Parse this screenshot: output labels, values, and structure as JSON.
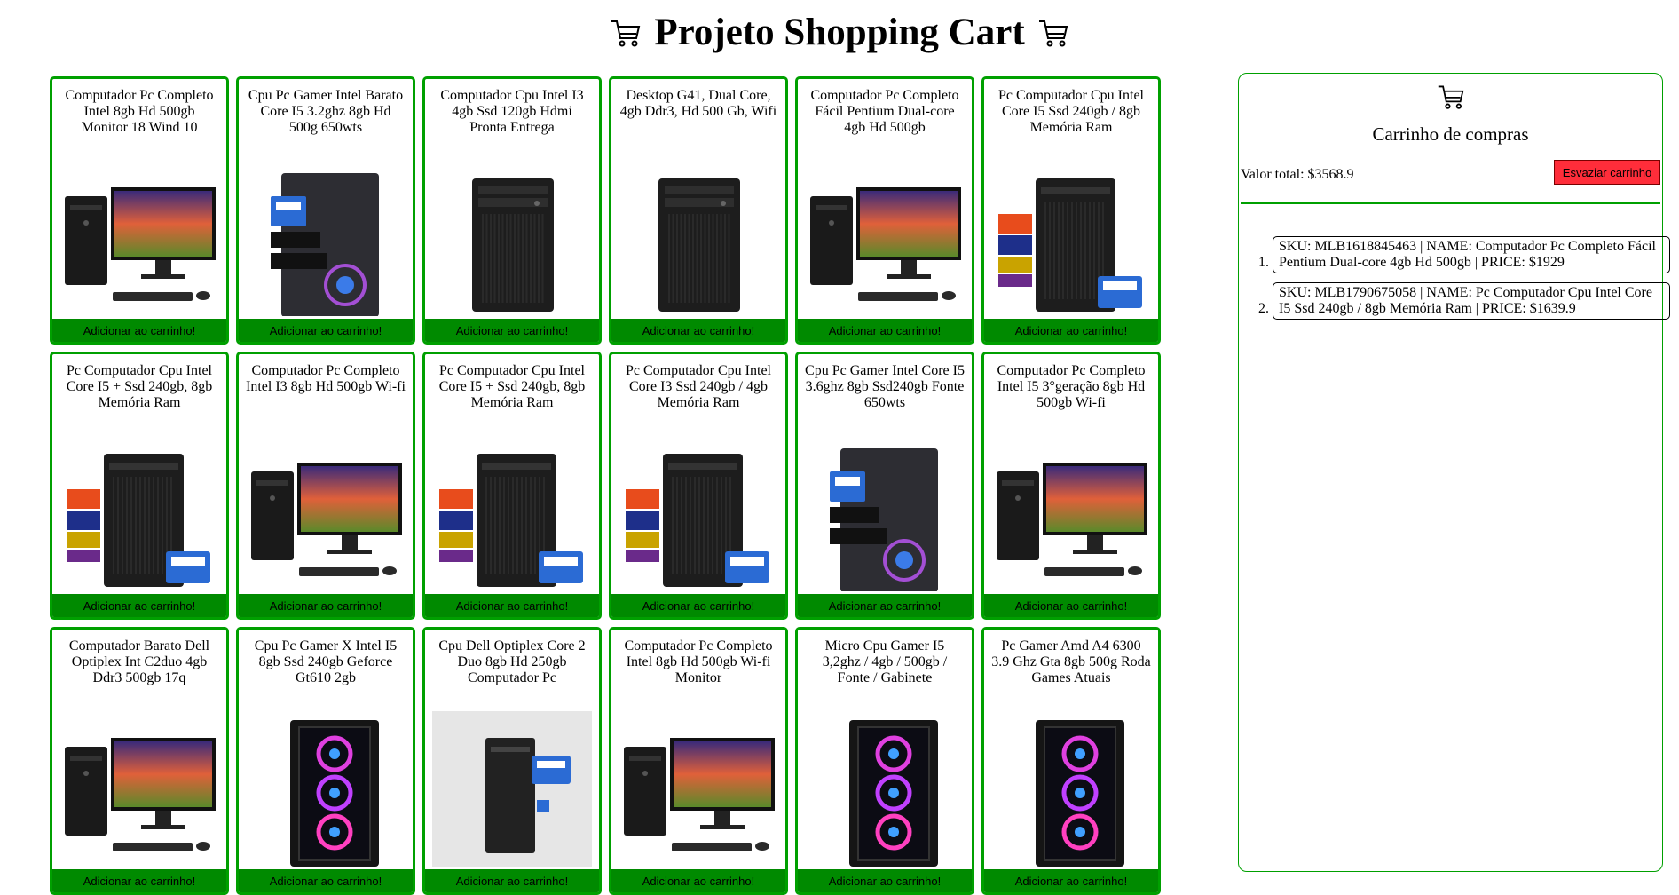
{
  "header": {
    "title": "Projeto Shopping Cart",
    "icon_left": "cart-icon",
    "icon_right": "cart-icon"
  },
  "products": [
    {
      "title": "Computador Pc Completo Intel 8gb Hd 500gb Monitor 18 Wind 10",
      "button": "Adicionar ao carrinho!",
      "image": "desktop-with-monitor"
    },
    {
      "title": "Cpu Pc Gamer Intel Barato Core I5 3.2ghz 8gb Hd 500g 650wts",
      "button": "Adicionar ao carrinho!",
      "image": "gamer-tower-stickers"
    },
    {
      "title": "Computador Cpu Intel I3 4gb Ssd 120gb Hdmi Pronta Entrega",
      "button": "Adicionar ao carrinho!",
      "image": "black-tower"
    },
    {
      "title": "Desktop G41, Dual Core, 4gb Ddr3, Hd 500 Gb, Wifi",
      "button": "Adicionar ao carrinho!",
      "image": "black-tower"
    },
    {
      "title": "Computador Pc Completo Fácil Pentium Dual-core 4gb Hd 500gb",
      "button": "Adicionar ao carrinho!",
      "image": "desktop-with-monitor"
    },
    {
      "title": "Pc Computador Cpu Intel Core I5 Ssd 240gb / 8gb Memória Ram",
      "button": "Adicionar ao carrinho!",
      "image": "tower-spec-labels"
    },
    {
      "title": "Pc Computador Cpu Intel Core I5 + Ssd 240gb, 8gb Memória Ram",
      "button": "Adicionar ao carrinho!",
      "image": "tower-spec-labels"
    },
    {
      "title": "Computador Pc Completo Intel I3 8gb Hd 500gb Wi-fi",
      "button": "Adicionar ao carrinho!",
      "image": "desktop-with-monitor"
    },
    {
      "title": "Pc Computador Cpu Intel Core I5 + Ssd 240gb, 8gb Memória Ram",
      "button": "Adicionar ao carrinho!",
      "image": "tower-spec-labels"
    },
    {
      "title": "Pc Computador Cpu Intel Core I3 Ssd 240gb / 4gb Memória Ram",
      "button": "Adicionar ao carrinho!",
      "image": "tower-spec-labels"
    },
    {
      "title": "Cpu Pc Gamer Intel Core I5 3.6ghz 8gb Ssd240gb Fonte 650wts",
      "button": "Adicionar ao carrinho!",
      "image": "gamer-tower-stickers"
    },
    {
      "title": "Computador Pc Completo Intel I5 3°geração 8gb Hd 500gb Wi-fi",
      "button": "Adicionar ao carrinho!",
      "image": "desktop-with-monitor"
    },
    {
      "title": "Computador Barato Dell Optiplex Int C2duo 4gb Ddr3 500gb 17q",
      "button": "Adicionar ao carrinho!",
      "image": "desktop-with-monitor"
    },
    {
      "title": "Cpu Pc Gamer X Intel I5 8gb Ssd 240gb Geforce Gt610 2gb",
      "button": "Adicionar ao carrinho!",
      "image": "gamer-tower-rgb"
    },
    {
      "title": "Cpu Dell Optiplex Core 2 Duo 8gb Hd 250gb Computador Pc",
      "button": "Adicionar ao carrinho!",
      "image": "slim-desktop"
    },
    {
      "title": "Computador Pc Completo Intel 8gb Hd 500gb Wi-fi Monitor",
      "button": "Adicionar ao carrinho!",
      "image": "desktop-with-monitor"
    },
    {
      "title": "Micro Cpu Gamer I5 3,2ghz / 4gb / 500gb / Fonte / Gabinete",
      "button": "Adicionar ao carrinho!",
      "image": "gamer-tower-rgb"
    },
    {
      "title": "Pc Gamer Amd A4 6300 3.9 Ghz Gta 8gb 500g Roda Games Atuais",
      "button": "Adicionar ao carrinho!",
      "image": "gamer-tower-rgb"
    }
  ],
  "cart": {
    "icon": "cart-icon",
    "title": "Carrinho de compras",
    "total_label": "Valor total: $3568.9",
    "empty_button": "Esvaziar carrinho",
    "items": [
      "SKU: MLB1618845463 | NAME: Computador Pc Completo Fácil Pentium Dual-core 4gb Hd 500gb | PRICE: $1929",
      "SKU: MLB1790675058 | NAME: Pc Computador Cpu Intel Core I5 Ssd 240gb / 8gb Memória Ram | PRICE: $1639.9"
    ]
  },
  "colors": {
    "card_border": "#00a000",
    "add_button_bg": "#008a00",
    "empty_button_bg": "#ff2d3a"
  }
}
